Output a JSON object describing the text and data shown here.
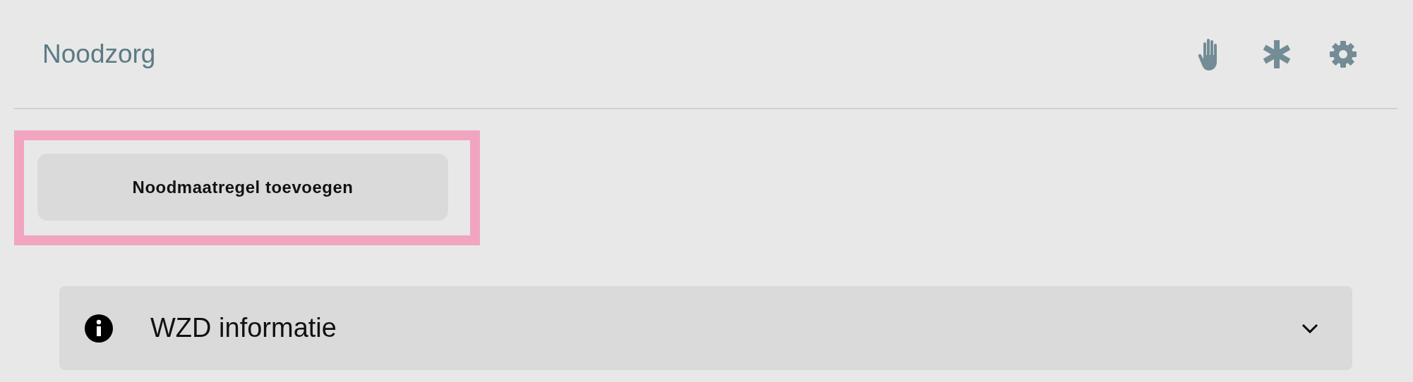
{
  "header": {
    "title": "Noodzorg",
    "actions": [
      {
        "kind": "hand"
      },
      {
        "kind": "asterisk"
      },
      {
        "kind": "gear"
      }
    ]
  },
  "highlight": {
    "shown": true
  },
  "add_button": {
    "label": "Noodmaatregel toevoegen"
  },
  "accordion": {
    "title": "WZD informatie",
    "expanded": false
  }
}
